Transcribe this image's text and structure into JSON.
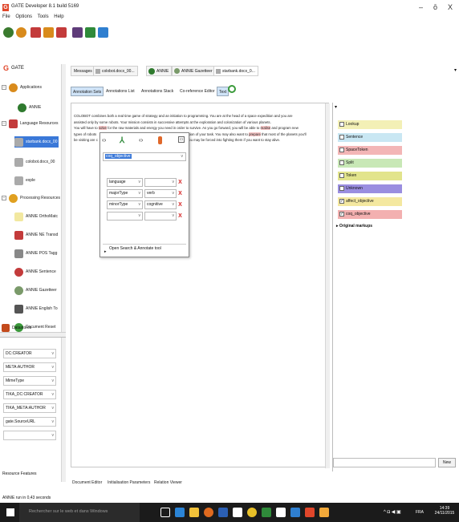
{
  "window": {
    "title": "GATE Developer 8.1 build 5169",
    "logo_letter": "G",
    "minimize": "–",
    "maximize": "ō",
    "close": "X"
  },
  "menu": [
    "File",
    "Options",
    "Tools",
    "Help"
  ],
  "toolbar": {
    "icons": [
      "load-app-icon",
      "new-app-icon",
      "new-lr-icon",
      "new-pr-icon",
      "datastore-icon",
      "plugins-icon",
      "annotation-diff-icon"
    ],
    "colors": [
      "#3a7a2e",
      "#d98b1c",
      "#c33b3b",
      "#c33b3b",
      "#5f3c7a",
      "#2f8a3a",
      "#2f7fd0"
    ]
  },
  "tree": {
    "root": "GATE",
    "items": [
      {
        "label": "Applications",
        "level": 1,
        "icon": "applications-icon"
      },
      {
        "label": "ANNIE",
        "level": 2,
        "icon": "annie-icon"
      },
      {
        "label": "Language Resources",
        "level": 1,
        "icon": "language-resources-icon"
      },
      {
        "label": "starbank.docx_00",
        "level": 2,
        "icon": "document-icon"
      },
      {
        "label": "colobot.docx_00",
        "level": 2,
        "icon": "document-icon"
      },
      {
        "label": "exple",
        "level": 2,
        "icon": "document-icon"
      },
      {
        "label": "Processing Resources",
        "level": 1,
        "icon": "processing-resources-icon"
      },
      {
        "label": "ANNIE OrthoMatc",
        "level": 2,
        "icon": "orthomatcher-icon"
      },
      {
        "label": "ANNIE NE Transd",
        "level": 2,
        "icon": "transducer-icon"
      },
      {
        "label": "ANNIE POS Tagg",
        "level": 2,
        "icon": "pos-tagger-icon"
      },
      {
        "label": "ANNIE Sentence",
        "level": 2,
        "icon": "sentence-splitter-icon"
      },
      {
        "label": "ANNIE Gazetteer",
        "level": 2,
        "icon": "gazetteer-icon"
      },
      {
        "label": "ANNIE English To",
        "level": 2,
        "icon": "tokeniser-icon"
      },
      {
        "label": "Document Reset",
        "level": 2,
        "icon": "document-reset-icon"
      },
      {
        "label": "Datastores",
        "level": 1,
        "icon": "datastores-icon"
      }
    ]
  },
  "features": {
    "rows": [
      "DC:CREATOR",
      "META:AUTHOR",
      "MimeType",
      "TIKA_DC:CREATOR",
      "TIKA_META:AUTHOR",
      "gate.SourceURL",
      ""
    ],
    "footer_label": "Resource Features"
  },
  "doc_tabs": [
    {
      "label": "Messages",
      "icon": ""
    },
    {
      "label": "colobot.docx_00...",
      "icon": "document-icon"
    },
    {
      "label": "ANNIE",
      "icon": "annie-icon"
    },
    {
      "label": "ANNIE Gazetteer",
      "icon": "gazetteer-icon"
    },
    {
      "label": "starbank.docx_0...",
      "icon": "document-icon"
    }
  ],
  "view_tabs": [
    "Annotation Sets",
    "Annotations List",
    "Annotations Stack",
    "Co-reference Editor",
    "Text"
  ],
  "document_text": {
    "line1": "COLOBOT combines both a real time game of strategy and an initiation to programming. You are at the head of a space expedition and you are",
    "line2": "assisted only by some robots. Your mission consists in successive attempts at the exploration and colonization of various planets.",
    "line3a": "You will have to ",
    "line3_hl": "solve",
    "line3b": " for the raw materials and energy you need in order to survive. As you go forward, you will be able to ",
    "line3_hl2": "realise",
    "line3c": " and program new",
    "line4a": "types of robots",
    "line4b": "letion of your task. You may also want to ",
    "line4_hl": "prepare",
    "line4c": " that most of the planets you'll",
    "line5a": "be visiting are c",
    "line5b": "hat you may be forced into fighting them if you want to stay alive."
  },
  "popup": {
    "type_value": "coq_objective",
    "features": [
      {
        "name": "language",
        "value": ""
      },
      {
        "name": "majorType",
        "value": "verb"
      },
      {
        "name": "minorType",
        "value": "cognitive"
      },
      {
        "name": "",
        "value": ""
      }
    ],
    "search_label": "Open Search & Annotate tool"
  },
  "annotation_types": [
    {
      "label": "Lookup",
      "color": "#f3f0b6",
      "checked": false
    },
    {
      "label": "Sentence",
      "color": "#c9e7f3",
      "checked": false
    },
    {
      "label": "SpaceToken",
      "color": "#f3b6b6",
      "checked": false
    },
    {
      "label": "Split",
      "color": "#c8e8b6",
      "checked": false
    },
    {
      "label": "Token",
      "color": "#e2e48c",
      "checked": false
    },
    {
      "label": "Unknown",
      "color": "#9a8ee0",
      "checked": false
    },
    {
      "label": "affect_objective",
      "color": "#f4e8a0",
      "checked": true
    },
    {
      "label": "coq_objective",
      "color": "#f3b0b0",
      "checked": true
    }
  ],
  "original_markups": "Original markups",
  "new_button": "New",
  "bottom_tabs": [
    "Document Editor",
    "Initialisation Parameters",
    "Relation Viewer"
  ],
  "status": "ANNIE run in 0,43 seconds",
  "taskbar": {
    "search_placeholder": "Rechercher sur le web et dans Windows",
    "time": "14:39",
    "date": "24/11/2015",
    "lang": "FRA",
    "apps": [
      {
        "name": "task-view-icon",
        "color": "#ffffff"
      },
      {
        "name": "edge-icon",
        "color": "#2b84d6"
      },
      {
        "name": "file-explorer-icon",
        "color": "#f2c23a"
      },
      {
        "name": "firefox-icon",
        "color": "#e06a1f"
      },
      {
        "name": "word-icon",
        "color": "#2b5fb4"
      },
      {
        "name": "app-icon",
        "color": "#ffffff"
      },
      {
        "name": "chrome-icon",
        "color": "#e8c028"
      },
      {
        "name": "excel-icon",
        "color": "#2f8a3a"
      },
      {
        "name": "photos-icon",
        "color": "#ffffff"
      },
      {
        "name": "outlook-icon",
        "color": "#2f7fd0"
      },
      {
        "name": "gate-icon",
        "color": "#e0462a"
      },
      {
        "name": "java-icon",
        "color": "#f2a93a"
      }
    ]
  }
}
